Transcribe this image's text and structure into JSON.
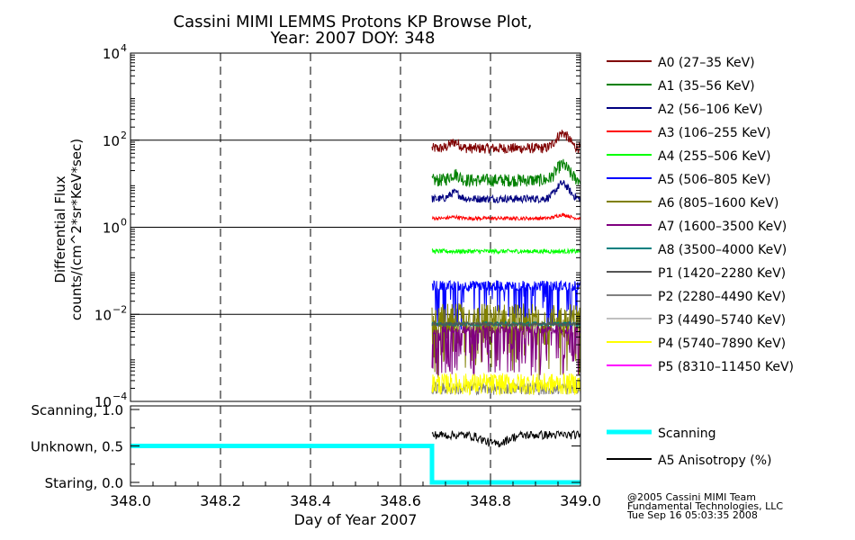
{
  "chart_data": [
    {
      "type": "line",
      "title": "Cassini MIMI LEMMS Protons KP Browse Plot,",
      "subtitle": "Year: 2007 DOY: 348",
      "ylabel_line1": "Differential Flux",
      "ylabel_line2": "counts/(cm^2*sr*KeV*sec)",
      "y_scale": "log",
      "xlim": [
        348.0,
        349.0
      ],
      "ylim": [
        0.0001,
        10000
      ],
      "y_ticks": [
        {
          "value": 10000,
          "base": "10",
          "exp": "4"
        },
        {
          "value": 100,
          "base": "10",
          "exp": "2"
        },
        {
          "value": 1,
          "base": "10",
          "exp": "0"
        },
        {
          "value": 0.01,
          "base": "10",
          "exp": "−2"
        },
        {
          "value": 0.0001,
          "base": "10",
          "exp": "−4"
        }
      ],
      "grid": {
        "vertical": "dashed",
        "horizontal": "solid"
      },
      "legend_position": "right",
      "data_x_range": [
        348.67,
        349.0
      ],
      "series": [
        {
          "name": "A0 (27–35 KeV)",
          "color": "#800000",
          "level": 65,
          "jitter": 0.12,
          "dips": 0,
          "bump": 0.35
        },
        {
          "name": "A1 (35–56 KeV)",
          "color": "#008000",
          "level": 12,
          "jitter": 0.15,
          "dips": 0,
          "bump": 0.35
        },
        {
          "name": "A2 (56–106 KeV)",
          "color": "#000080",
          "level": 4.5,
          "jitter": 0.09,
          "dips": 0,
          "bump": 0.35
        },
        {
          "name": "A3 (106–255 KeV)",
          "color": "#ff0000",
          "level": 1.6,
          "jitter": 0.04,
          "dips": 0,
          "bump": 0.08
        },
        {
          "name": "A4 (255–506 KeV)",
          "color": "#00ff00",
          "level": 0.28,
          "jitter": 0.05,
          "dips": 0,
          "bump": 0
        },
        {
          "name": "A5 (506–805 KeV)",
          "color": "#0000ff",
          "level": 0.045,
          "jitter": 0.12,
          "dips": 0.18,
          "bump": 0
        },
        {
          "name": "A6 (805–1600 KeV)",
          "color": "#808000",
          "level": 0.008,
          "jitter": 0.35,
          "dips": 0.3,
          "bump": 0
        },
        {
          "name": "A7 (1600–3500 KeV)",
          "color": "#800080",
          "level": 0.0045,
          "jitter": 0.1,
          "dips": 0.3,
          "bump": 0
        },
        {
          "name": "A8 (3500–4000 KeV)",
          "color": "#008080",
          "level": 0.006,
          "jitter": 0.05,
          "dips": 0,
          "bump": 0
        },
        {
          "name": "P1 (1420–2280 KeV)",
          "color": "#555555",
          "level": 0.006,
          "jitter": 0.04,
          "dips": 0,
          "bump": 0
        },
        {
          "name": "P2 (2280–4490 KeV)",
          "color": "#808080",
          "level": 0.0002,
          "jitter": 0.15,
          "dips": 0,
          "bump": 0
        },
        {
          "name": "P3 (4490–5740 KeV)",
          "color": "#c0c0c0",
          "level": 0,
          "jitter": 0,
          "dips": 0,
          "bump": 0
        },
        {
          "name": "P4 (5740–7890 KeV)",
          "color": "#ffff00",
          "level": 0.00025,
          "jitter": 0.25,
          "dips": 0,
          "bump": 0
        },
        {
          "name": "P5 (8310–11450 KeV)",
          "color": "#ff00ff",
          "level": 0,
          "jitter": 0,
          "dips": 0,
          "bump": 0
        }
      ]
    },
    {
      "type": "line",
      "xlabel": "Day of Year 2007",
      "xlim": [
        348.0,
        349.0
      ],
      "x_ticks": [
        "348.0",
        "348.2",
        "348.4",
        "348.6",
        "348.8",
        "349.0"
      ],
      "ylim": [
        0,
        1
      ],
      "y_ticks": [
        {
          "value": 1.0,
          "label": "Scanning, 1.0"
        },
        {
          "value": 0.5,
          "label": "Unknown, 0.5"
        },
        {
          "value": 0.0,
          "label": "Staring, 0.0"
        }
      ],
      "grid": {
        "vertical": "dashed",
        "horizontal": "none"
      },
      "series": [
        {
          "name": "Scanning",
          "color": "#00ffff",
          "points": [
            [
              348.0,
              0.5
            ],
            [
              348.67,
              0.5
            ],
            [
              348.67,
              0.0
            ],
            [
              349.0,
              0.0
            ]
          ]
        },
        {
          "name": "A5 Anisotropy (%)",
          "color": "#000000",
          "level": 0.65,
          "jitter": 0.06,
          "x_range": [
            348.67,
            349.0
          ]
        }
      ]
    }
  ],
  "credits": {
    "line1": "@2005 Cassini MIMI Team",
    "line2": "Fundamental Technologies, LLC",
    "line3": "Tue Sep 16 05:03:35 2008"
  }
}
